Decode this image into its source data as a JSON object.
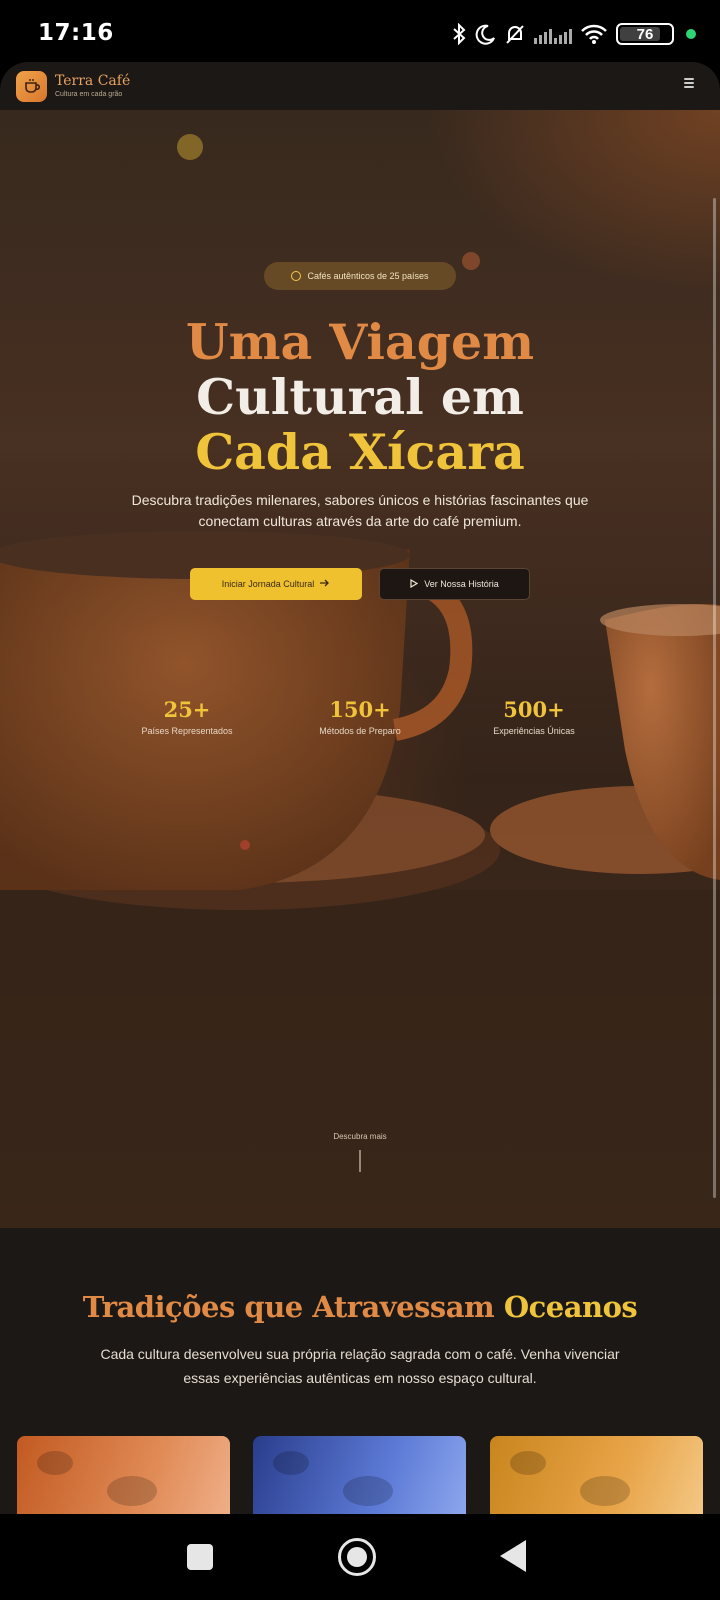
{
  "status_bar": {
    "time": "17:16",
    "battery": "76",
    "icons": [
      "bluetooth-icon",
      "moon-icon",
      "mute-icon",
      "signal-icon",
      "wifi-icon",
      "battery-icon"
    ]
  },
  "header": {
    "brand_name": "Terra Café",
    "tagline": "Cultura em cada grão",
    "logo_icon": "coffee-cup-icon",
    "menu_icon": "menu-icon"
  },
  "hero": {
    "badge": "Cafés autênticos de 25 países",
    "headline": [
      "Uma Viagem",
      "Cultural em",
      "Cada Xícara"
    ],
    "subtitle": "Descubra tradições milenares, sabores únicos e histórias fascinantes que conectam culturas através da arte do café premium.",
    "primary_button": "Iniciar Jornada Cultural",
    "secondary_button": "Ver Nossa História",
    "stats": [
      {
        "value": "25+",
        "label": "Países Representados"
      },
      {
        "value": "150+",
        "label": "Métodos de Preparo"
      },
      {
        "value": "500+",
        "label": "Experiências Únicas"
      }
    ],
    "scroll_hint": "Descubra mais"
  },
  "traditions": {
    "title_part1": "Tradições que Atravessam",
    "title_part2": "Oceanos",
    "text": "Cada cultura desenvolveu sua própria relação sagrada com o café. Venha vivenciar essas experiências autênticas em nosso espaço cultural."
  },
  "colors": {
    "accent_orange": "#e08a45",
    "accent_gold": "#f0c43a",
    "header_bg": "#1c1816",
    "section_bg": "#1c1815"
  }
}
